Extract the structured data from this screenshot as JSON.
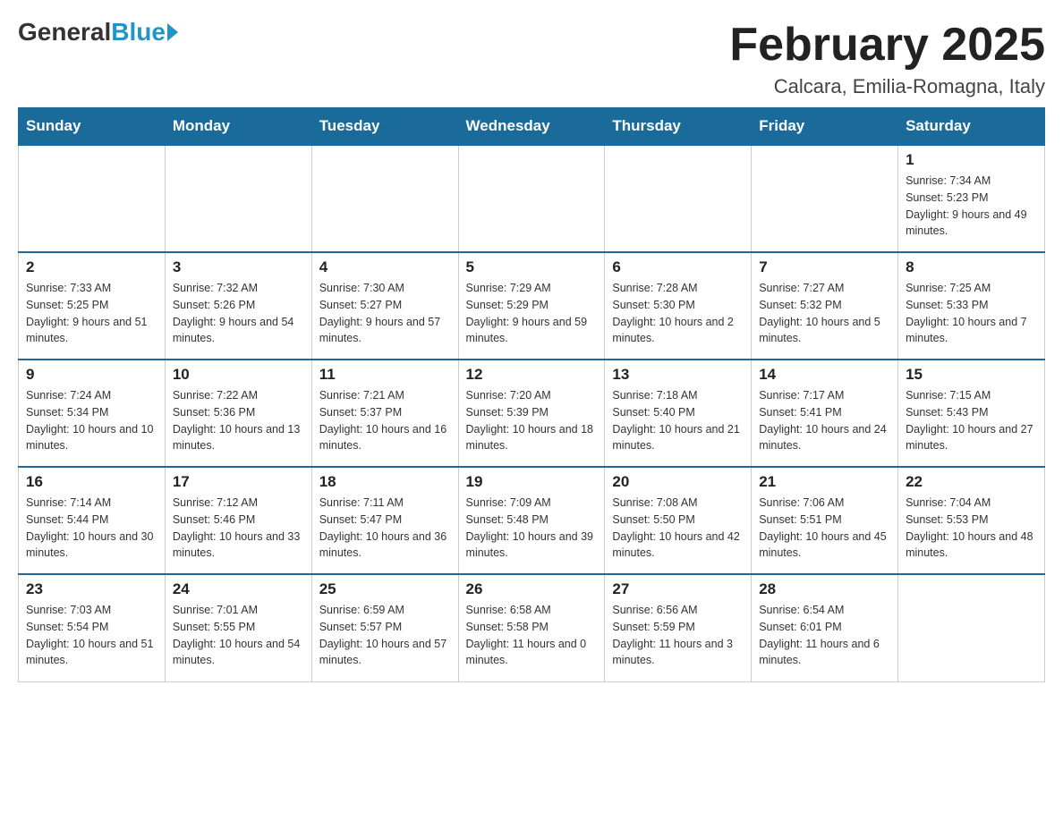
{
  "header": {
    "logo_general": "General",
    "logo_blue": "Blue",
    "month_title": "February 2025",
    "location": "Calcara, Emilia-Romagna, Italy"
  },
  "days_of_week": [
    "Sunday",
    "Monday",
    "Tuesday",
    "Wednesday",
    "Thursday",
    "Friday",
    "Saturday"
  ],
  "weeks": [
    [
      {
        "day": "",
        "info": ""
      },
      {
        "day": "",
        "info": ""
      },
      {
        "day": "",
        "info": ""
      },
      {
        "day": "",
        "info": ""
      },
      {
        "day": "",
        "info": ""
      },
      {
        "day": "",
        "info": ""
      },
      {
        "day": "1",
        "info": "Sunrise: 7:34 AM\nSunset: 5:23 PM\nDaylight: 9 hours and 49 minutes."
      }
    ],
    [
      {
        "day": "2",
        "info": "Sunrise: 7:33 AM\nSunset: 5:25 PM\nDaylight: 9 hours and 51 minutes."
      },
      {
        "day": "3",
        "info": "Sunrise: 7:32 AM\nSunset: 5:26 PM\nDaylight: 9 hours and 54 minutes."
      },
      {
        "day": "4",
        "info": "Sunrise: 7:30 AM\nSunset: 5:27 PM\nDaylight: 9 hours and 57 minutes."
      },
      {
        "day": "5",
        "info": "Sunrise: 7:29 AM\nSunset: 5:29 PM\nDaylight: 9 hours and 59 minutes."
      },
      {
        "day": "6",
        "info": "Sunrise: 7:28 AM\nSunset: 5:30 PM\nDaylight: 10 hours and 2 minutes."
      },
      {
        "day": "7",
        "info": "Sunrise: 7:27 AM\nSunset: 5:32 PM\nDaylight: 10 hours and 5 minutes."
      },
      {
        "day": "8",
        "info": "Sunrise: 7:25 AM\nSunset: 5:33 PM\nDaylight: 10 hours and 7 minutes."
      }
    ],
    [
      {
        "day": "9",
        "info": "Sunrise: 7:24 AM\nSunset: 5:34 PM\nDaylight: 10 hours and 10 minutes."
      },
      {
        "day": "10",
        "info": "Sunrise: 7:22 AM\nSunset: 5:36 PM\nDaylight: 10 hours and 13 minutes."
      },
      {
        "day": "11",
        "info": "Sunrise: 7:21 AM\nSunset: 5:37 PM\nDaylight: 10 hours and 16 minutes."
      },
      {
        "day": "12",
        "info": "Sunrise: 7:20 AM\nSunset: 5:39 PM\nDaylight: 10 hours and 18 minutes."
      },
      {
        "day": "13",
        "info": "Sunrise: 7:18 AM\nSunset: 5:40 PM\nDaylight: 10 hours and 21 minutes."
      },
      {
        "day": "14",
        "info": "Sunrise: 7:17 AM\nSunset: 5:41 PM\nDaylight: 10 hours and 24 minutes."
      },
      {
        "day": "15",
        "info": "Sunrise: 7:15 AM\nSunset: 5:43 PM\nDaylight: 10 hours and 27 minutes."
      }
    ],
    [
      {
        "day": "16",
        "info": "Sunrise: 7:14 AM\nSunset: 5:44 PM\nDaylight: 10 hours and 30 minutes."
      },
      {
        "day": "17",
        "info": "Sunrise: 7:12 AM\nSunset: 5:46 PM\nDaylight: 10 hours and 33 minutes."
      },
      {
        "day": "18",
        "info": "Sunrise: 7:11 AM\nSunset: 5:47 PM\nDaylight: 10 hours and 36 minutes."
      },
      {
        "day": "19",
        "info": "Sunrise: 7:09 AM\nSunset: 5:48 PM\nDaylight: 10 hours and 39 minutes."
      },
      {
        "day": "20",
        "info": "Sunrise: 7:08 AM\nSunset: 5:50 PM\nDaylight: 10 hours and 42 minutes."
      },
      {
        "day": "21",
        "info": "Sunrise: 7:06 AM\nSunset: 5:51 PM\nDaylight: 10 hours and 45 minutes."
      },
      {
        "day": "22",
        "info": "Sunrise: 7:04 AM\nSunset: 5:53 PM\nDaylight: 10 hours and 48 minutes."
      }
    ],
    [
      {
        "day": "23",
        "info": "Sunrise: 7:03 AM\nSunset: 5:54 PM\nDaylight: 10 hours and 51 minutes."
      },
      {
        "day": "24",
        "info": "Sunrise: 7:01 AM\nSunset: 5:55 PM\nDaylight: 10 hours and 54 minutes."
      },
      {
        "day": "25",
        "info": "Sunrise: 6:59 AM\nSunset: 5:57 PM\nDaylight: 10 hours and 57 minutes."
      },
      {
        "day": "26",
        "info": "Sunrise: 6:58 AM\nSunset: 5:58 PM\nDaylight: 11 hours and 0 minutes."
      },
      {
        "day": "27",
        "info": "Sunrise: 6:56 AM\nSunset: 5:59 PM\nDaylight: 11 hours and 3 minutes."
      },
      {
        "day": "28",
        "info": "Sunrise: 6:54 AM\nSunset: 6:01 PM\nDaylight: 11 hours and 6 minutes."
      },
      {
        "day": "",
        "info": ""
      }
    ]
  ]
}
